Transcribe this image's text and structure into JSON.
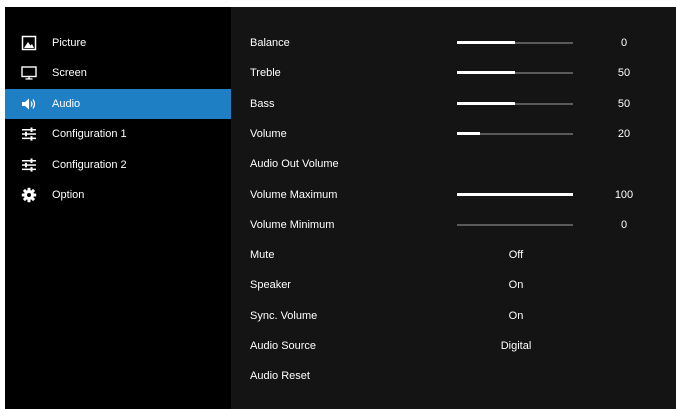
{
  "sidebar": {
    "items": [
      {
        "label": "Picture",
        "icon": "picture-icon",
        "selected": false
      },
      {
        "label": "Screen",
        "icon": "monitor-icon",
        "selected": false
      },
      {
        "label": "Audio",
        "icon": "speaker-icon",
        "selected": true
      },
      {
        "label": "Configuration 1",
        "icon": "sliders-icon",
        "selected": false
      },
      {
        "label": "Configuration 2",
        "icon": "sliders-icon",
        "selected": false
      },
      {
        "label": "Option",
        "icon": "gear-icon",
        "selected": false
      }
    ]
  },
  "colors": {
    "sidebar_bg": "#000000",
    "panel_bg": "#141414",
    "selected_bg": "#1f7fc4",
    "slider_fill": "#ffffff",
    "slider_track": "#5a5a5a",
    "text": "#ffffff"
  },
  "audio": {
    "rows": [
      {
        "label": "Balance",
        "type": "slider",
        "value": "0",
        "fill_fraction": 0.5
      },
      {
        "label": "Treble",
        "type": "slider",
        "value": "50",
        "fill_fraction": 0.5
      },
      {
        "label": "Bass",
        "type": "slider",
        "value": "50",
        "fill_fraction": 0.5
      },
      {
        "label": "Volume",
        "type": "slider",
        "value": "20",
        "fill_fraction": 0.2
      },
      {
        "label": "Audio Out Volume",
        "type": "label",
        "value": ""
      },
      {
        "label": "Volume Maximum",
        "type": "slider",
        "value": "100",
        "fill_fraction": 1.0
      },
      {
        "label": "Volume Minimum",
        "type": "slider",
        "value": "0",
        "fill_fraction": 0.0
      },
      {
        "label": "Mute",
        "type": "text",
        "value": "Off"
      },
      {
        "label": "Speaker",
        "type": "text",
        "value": "On"
      },
      {
        "label": "Sync. Volume",
        "type": "text",
        "value": "On"
      },
      {
        "label": "Audio Source",
        "type": "text",
        "value": "Digital"
      },
      {
        "label": "Audio Reset",
        "type": "label",
        "value": ""
      }
    ]
  }
}
